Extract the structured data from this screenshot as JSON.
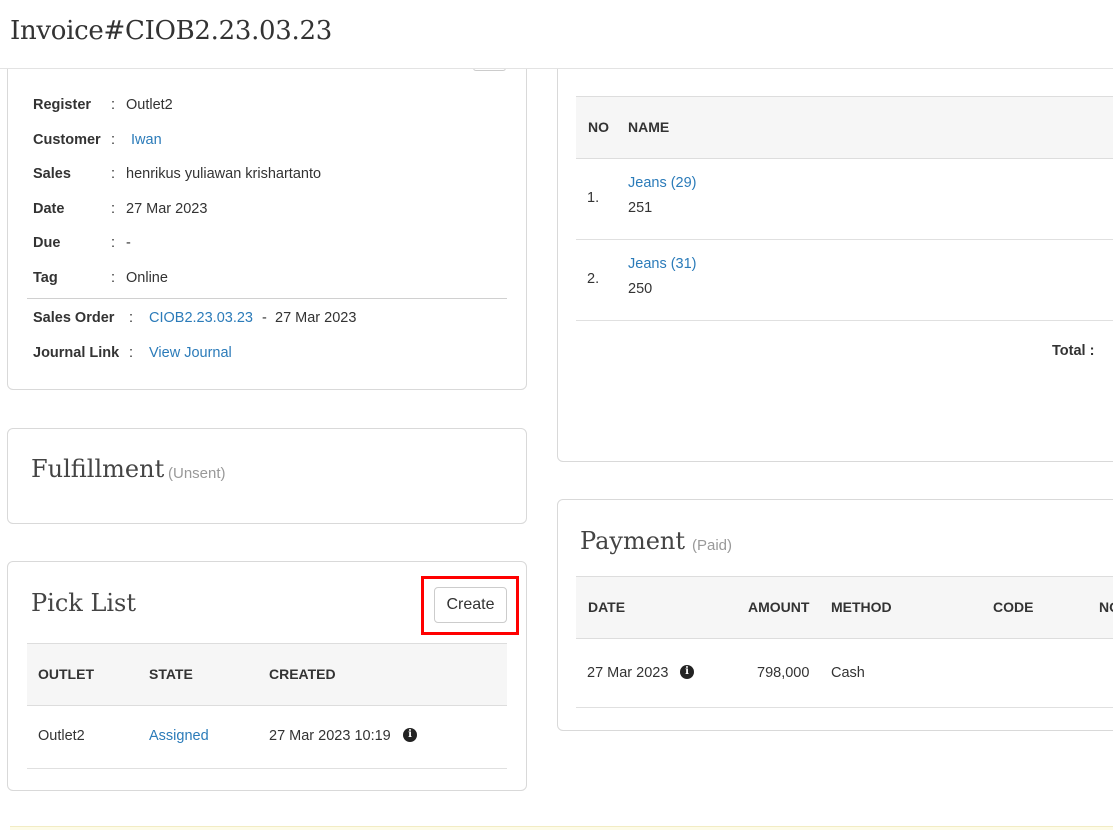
{
  "header": {
    "title": "Invoice#CIOB2.23.03.23"
  },
  "details": {
    "rows": [
      {
        "label": "Register",
        "value": "Outlet2"
      },
      {
        "label": "Customer",
        "value": "Iwan"
      },
      {
        "label": "Sales",
        "value": "henrikus yuliawan krishartanto"
      },
      {
        "label": "Date",
        "value": "27 Mar 2023"
      },
      {
        "label": "Due",
        "value": "-"
      },
      {
        "label": "Tag",
        "value": "Online"
      }
    ],
    "sales_order": {
      "label": "Sales Order",
      "code": "CIOB2.23.03.23",
      "separator": "-",
      "date": "27 Mar 2023"
    },
    "journal": {
      "label": "Journal Link",
      "link": "View Journal"
    },
    "colon": ":"
  },
  "fulfillment": {
    "title": "Fulfillment",
    "status": "(Unsent)"
  },
  "pick_list": {
    "title": "Pick List",
    "create_label": "Create",
    "columns": [
      "OUTLET",
      "STATE",
      "CREATED"
    ],
    "rows": [
      {
        "outlet": "Outlet2",
        "state": "Assigned",
        "created": "27 Mar 2023 10:19",
        "info": "i"
      }
    ]
  },
  "items": {
    "columns": [
      "NO",
      "NAME"
    ],
    "rows": [
      {
        "no": "1.",
        "name": "Jeans (29)",
        "code": "251"
      },
      {
        "no": "2.",
        "name": "Jeans (31)",
        "code": "250"
      }
    ],
    "total_label": "Total :"
  },
  "payment": {
    "title": "Payment",
    "status": "(Paid)",
    "columns": [
      "DATE",
      "AMOUNT",
      "METHOD",
      "CODE",
      "NO"
    ],
    "rows": [
      {
        "date": "27 Mar 2023",
        "info": "i",
        "amount": "798,000",
        "method": "Cash"
      }
    ]
  },
  "colors": {
    "link": "#2b7bb9",
    "highlight": "#ff0000",
    "border": "#d9d9d9",
    "table_header_bg": "#f6f6f6"
  }
}
